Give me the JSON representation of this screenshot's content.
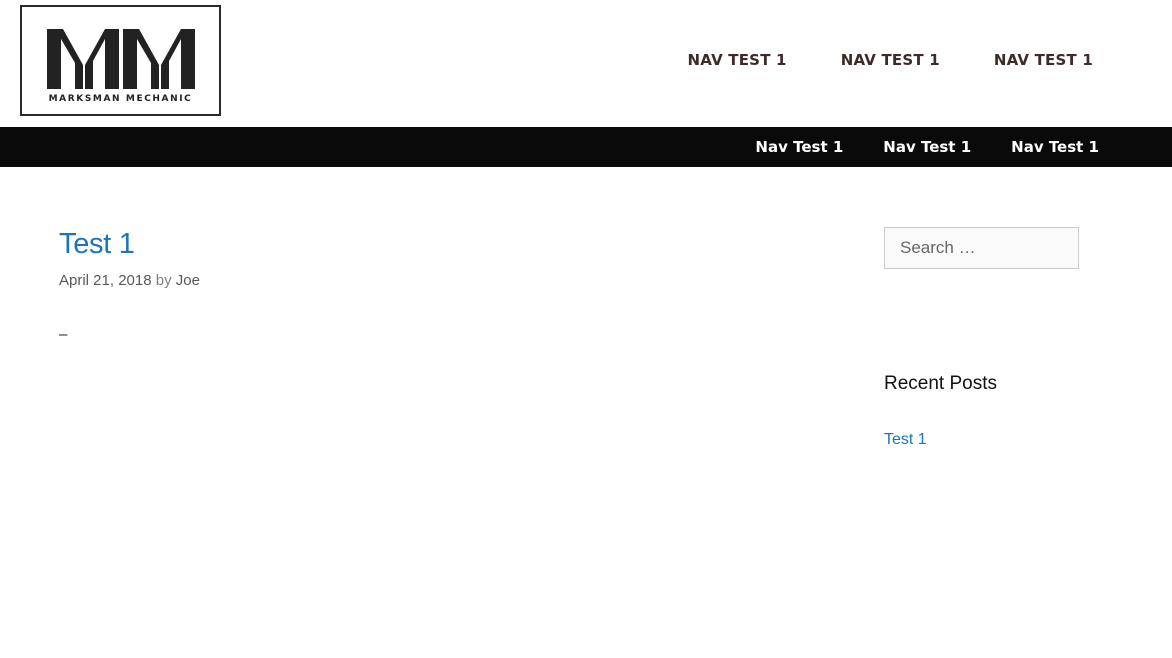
{
  "header": {
    "logo_text": "MARKSMAN MECHANIC",
    "logo_mark": "MM",
    "primary_nav": [
      "NAV TEST 1",
      "NAV TEST 1",
      "NAV TEST 1"
    ]
  },
  "secondary_nav": [
    "Nav Test 1",
    "Nav Test 1",
    "Nav Test 1"
  ],
  "post": {
    "title": "Test 1",
    "date": "April 21, 2018",
    "by": "by",
    "author": "Joe",
    "body": "–"
  },
  "sidebar": {
    "search_placeholder": "Search …",
    "recent_posts_title": "Recent Posts",
    "recent_posts": [
      "Test 1"
    ]
  },
  "colors": {
    "link": "#1e73be",
    "nav_bar_bg": "#0a0a0a",
    "primary_nav_text": "#3d2a2a"
  }
}
